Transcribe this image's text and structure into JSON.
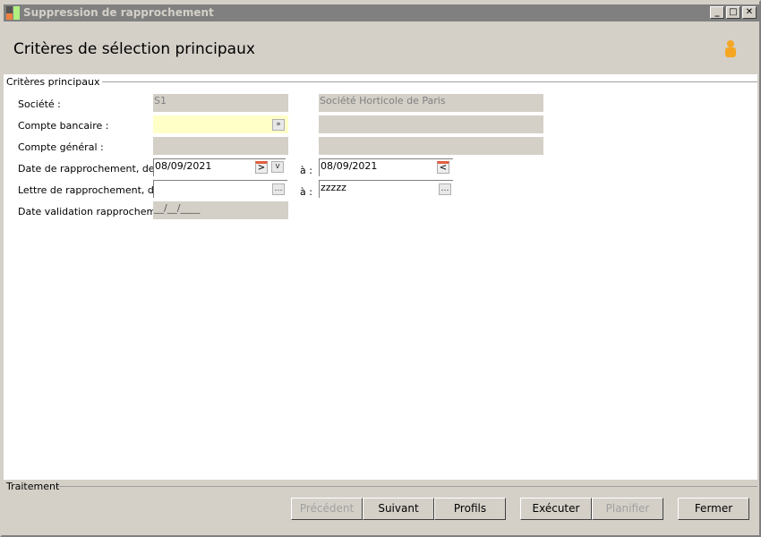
{
  "window": {
    "title": "Suppression de rapprochement",
    "minimize": "_",
    "maximize": "□",
    "close": "✕"
  },
  "header": {
    "title": "Critères de sélection principaux",
    "icon": "user-icon"
  },
  "section": {
    "legend": "Critères principaux"
  },
  "fields": {
    "societe": {
      "label": "Société :",
      "code": "S1",
      "name": "Société Horticole de Paris"
    },
    "compte_bancaire": {
      "label": "Compte bancaire :",
      "value": "",
      "desc": ""
    },
    "compte_general": {
      "label": "Compte général :",
      "value": "",
      "desc": ""
    },
    "date_rappro": {
      "label": "Date de rapprochement, de :",
      "from": "08/09/2021",
      "to_label": "à :",
      "to": "08/09/2021"
    },
    "lettre_rappro": {
      "label": "Lettre de rapprochement, de :",
      "from": "",
      "to_label": "à :",
      "to": "zzzzz"
    },
    "date_validation": {
      "label": "Date validation rapprochement :",
      "value": "__/__/____"
    }
  },
  "footer": {
    "legend": "Traitement",
    "buttons": {
      "precedent": "Précédent",
      "suivant": "Suivant",
      "profils": "Profils",
      "executer": "Exécuter",
      "planifier": "Planifier",
      "fermer": "Fermer"
    }
  }
}
